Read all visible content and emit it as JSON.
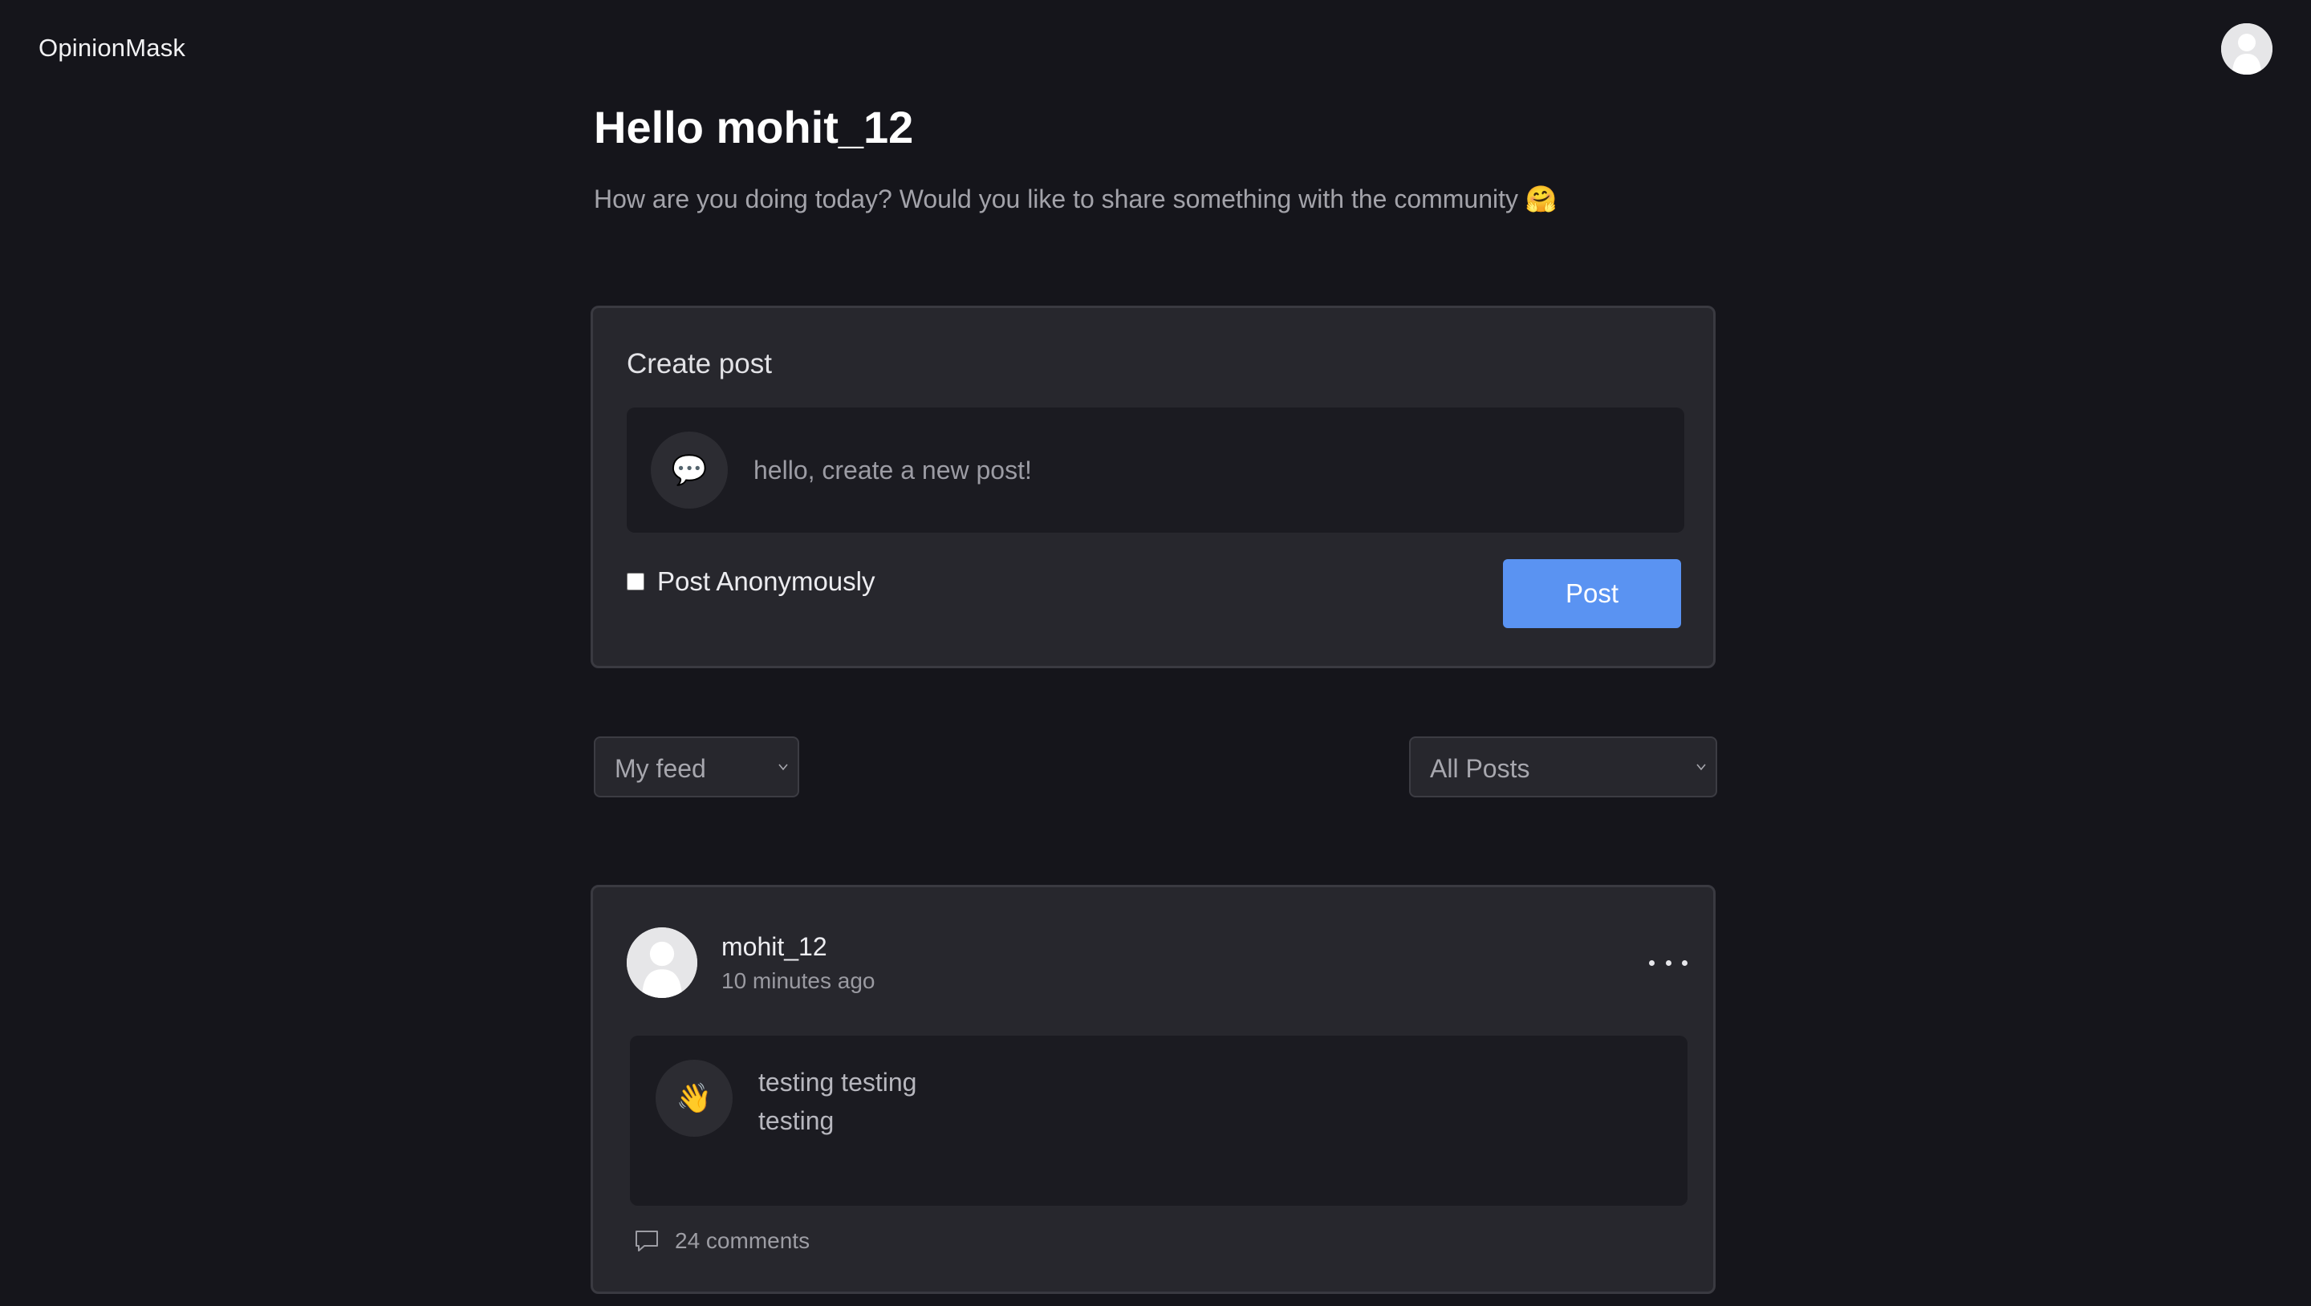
{
  "app": {
    "logo": "OpinionMask"
  },
  "header": {
    "greeting": "Hello mohit_12",
    "subtitle": "How are you doing today? Would you like to share something with the community 🤗"
  },
  "create_post": {
    "title": "Create post",
    "emoji": "💬",
    "placeholder": "hello, create a new post!",
    "value": "",
    "anonymous_label": "Post Anonymously",
    "anonymous_checked": false,
    "post_button_label": "Post"
  },
  "filters": {
    "feed_selected": "My feed",
    "posts_selected": "All Posts"
  },
  "posts": [
    {
      "author": "mohit_12",
      "time": "10 minutes ago",
      "emoji": "👋",
      "text": "testing testing\ntesting",
      "comments_label": "24 comments"
    }
  ],
  "colors": {
    "background": "#15151b",
    "card": "#27272d",
    "inner": "#1b1b21",
    "accent": "#5a93f2"
  },
  "icons": {
    "avatar": "user-silhouette-icon",
    "more": "ellipsis-icon",
    "comment": "speech-bubble-icon",
    "chevron": "chevron-down-icon"
  }
}
